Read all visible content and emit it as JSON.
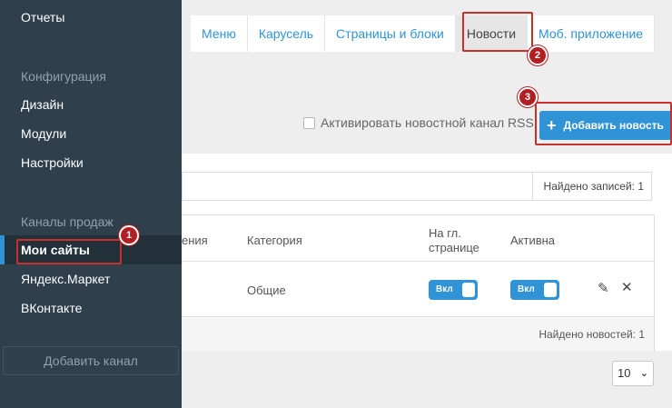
{
  "sidebar": {
    "top_item": "Отчеты",
    "config_section": "Конфигурация",
    "config_items": [
      "Дизайн",
      "Модули",
      "Настройки"
    ],
    "channels_section": "Каналы продаж",
    "channel_items": [
      "Мои сайты",
      "Яндекс.Маркет",
      "ВКонтакте"
    ],
    "add_channel": "Добавить канал"
  },
  "tabs": [
    "Меню",
    "Карусель",
    "Страницы и блоки",
    "Новости",
    "Моб. приложение"
  ],
  "active_tab": "Новости",
  "badges": [
    "1",
    "2",
    "3"
  ],
  "rss_label": "Активировать новостной канал RSS",
  "add_news_label": "Добавить новость",
  "found_records": "Найдено записей: 1",
  "table": {
    "headers": {
      "date_partial": "ения",
      "category": "Категория",
      "on_main_line1": "На гл.",
      "on_main_line2": "странице",
      "active": "Активна"
    },
    "row": {
      "category": "Общие",
      "toggle_main": "Вкл",
      "toggle_active": "Вкл"
    },
    "footer": "Найдено новостей: 1"
  },
  "per_page": "10",
  "colors": {
    "accent": "#2f93d6",
    "sidebar": "#2f3f4c",
    "highlight": "#c9302c"
  },
  "icons": {
    "plus": "plus-icon",
    "edit": "pencil-icon",
    "delete": "close-icon",
    "chevron": "chevron-down-icon"
  }
}
